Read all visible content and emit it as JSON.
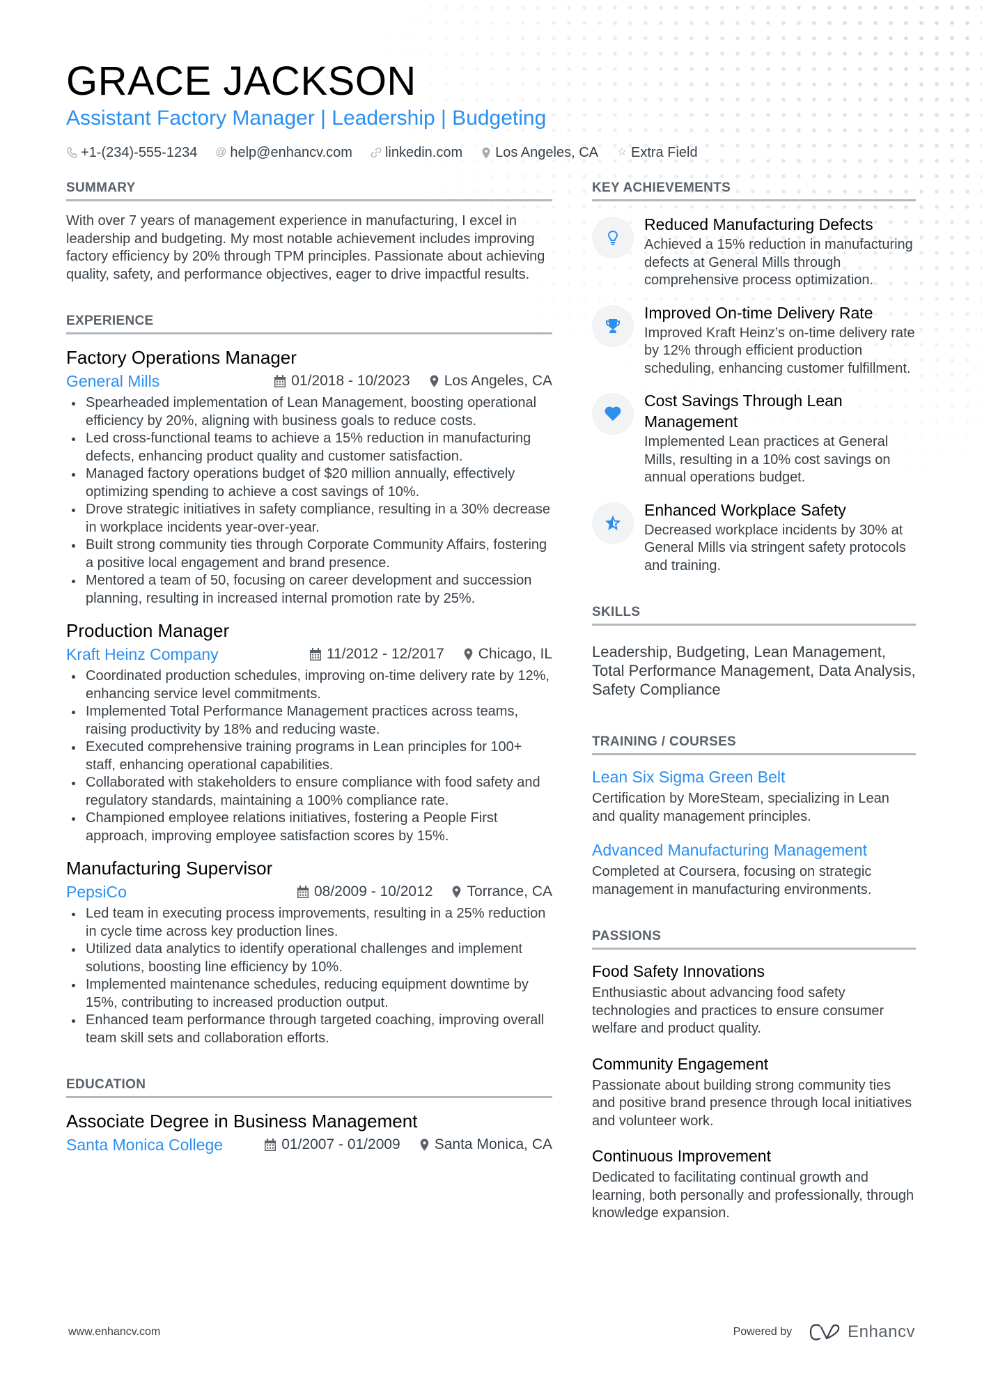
{
  "header": {
    "name": "GRACE JACKSON",
    "title": "Assistant Factory Manager | Leadership | Budgeting",
    "contacts": [
      {
        "icon": "phone-icon",
        "text": "+1-(234)-555-1234"
      },
      {
        "icon": "at-icon",
        "text": "help@enhancv.com"
      },
      {
        "icon": "link-icon",
        "text": "linkedin.com"
      },
      {
        "icon": "location-icon",
        "text": "Los Angeles, CA"
      },
      {
        "icon": "star-icon",
        "text": "Extra Field"
      }
    ]
  },
  "summary": {
    "heading": "SUMMARY",
    "text": "With over 7 years of management experience in manufacturing, I excel in leadership and budgeting. My most notable achievement includes improving factory efficiency by 20% through TPM principles. Passionate about achieving quality, safety, and performance objectives, eager to drive impactful results."
  },
  "experience": {
    "heading": "EXPERIENCE",
    "jobs": [
      {
        "title": "Factory Operations Manager",
        "company": "General Mills",
        "dates": "01/2018 - 10/2023",
        "location": "Los Angeles, CA",
        "bullets": [
          "Spearheaded implementation of Lean Management, boosting operational efficiency by 20%, aligning with business goals to reduce costs.",
          "Led cross-functional teams to achieve a 15% reduction in manufacturing defects, enhancing product quality and customer satisfaction.",
          "Managed factory operations budget of $20 million annually, effectively optimizing spending to achieve a cost savings of 10%.",
          "Drove strategic initiatives in safety compliance, resulting in a 30% decrease in workplace incidents year-over-year.",
          "Built strong community ties through Corporate Community Affairs, fostering a positive local engagement and brand presence.",
          "Mentored a team of 50, focusing on career development and succession planning, resulting in increased internal promotion rate by 25%."
        ]
      },
      {
        "title": "Production Manager",
        "company": "Kraft Heinz Company",
        "dates": "11/2012 - 12/2017",
        "location": "Chicago, IL",
        "bullets": [
          "Coordinated production schedules, improving on-time delivery rate by 12%, enhancing service level commitments.",
          "Implemented Total Performance Management practices across teams, raising productivity by 18% and reducing waste.",
          "Executed comprehensive training programs in Lean principles for 100+ staff, enhancing operational capabilities.",
          "Collaborated with stakeholders to ensure compliance with food safety and regulatory standards, maintaining a 100% compliance rate.",
          "Championed employee relations initiatives, fostering a People First approach, improving employee satisfaction scores by 15%."
        ]
      },
      {
        "title": "Manufacturing Supervisor",
        "company": "PepsiCo",
        "dates": "08/2009 - 10/2012",
        "location": "Torrance, CA",
        "bullets": [
          "Led team in executing process improvements, resulting in a 25% reduction in cycle time across key production lines.",
          "Utilized data analytics to identify operational challenges and implement solutions, boosting line efficiency by 10%.",
          "Implemented maintenance schedules, reducing equipment downtime by 15%, contributing to increased production output.",
          "Enhanced team performance through targeted coaching, improving overall team skill sets and collaboration efforts."
        ]
      }
    ]
  },
  "education": {
    "heading": "EDUCATION",
    "items": [
      {
        "degree": "Associate Degree in Business Management",
        "school": "Santa Monica College",
        "dates": "01/2007 - 01/2009",
        "location": "Santa Monica, CA"
      }
    ]
  },
  "achievements": {
    "heading": "KEY ACHIEVEMENTS",
    "items": [
      {
        "icon": "lightbulb-icon",
        "title": "Reduced Manufacturing Defects",
        "desc": "Achieved a 15% reduction in manufacturing defects at General Mills through comprehensive process optimization."
      },
      {
        "icon": "trophy-icon",
        "title": "Improved On-time Delivery Rate",
        "desc": "Improved Kraft Heinz’s on-time delivery rate by 12% through efficient production scheduling, enhancing customer fulfillment."
      },
      {
        "icon": "heart-icon",
        "title": "Cost Savings Through Lean Management",
        "desc": "Implemented Lean practices at General Mills, resulting in a 10% cost savings on annual operations budget."
      },
      {
        "icon": "star-icon",
        "title": "Enhanced Workplace Safety",
        "desc": "Decreased workplace incidents by 30% at General Mills via stringent safety protocols and training."
      }
    ]
  },
  "skills": {
    "heading": "SKILLS",
    "text": "Leadership, Budgeting, Lean Management, Total Performance Management, Data Analysis, Safety Compliance"
  },
  "training": {
    "heading": "TRAINING / COURSES",
    "items": [
      {
        "title": "Lean Six Sigma Green Belt",
        "desc": "Certification by MoreSteam, specializing in Lean and quality management principles."
      },
      {
        "title": "Advanced Manufacturing Management",
        "desc": "Completed at Coursera, focusing on strategic management in manufacturing environments."
      }
    ]
  },
  "passions": {
    "heading": "PASSIONS",
    "items": [
      {
        "title": "Food Safety Innovations",
        "desc": "Enthusiastic about advancing food safety technologies and practices to ensure consumer welfare and product quality."
      },
      {
        "title": "Community Engagement",
        "desc": "Passionate about building strong community ties and positive brand presence through local initiatives and volunteer work."
      },
      {
        "title": "Continuous Improvement",
        "desc": "Dedicated to facilitating continual growth and learning, both personally and professionally, through knowledge expansion."
      }
    ]
  },
  "footer": {
    "website": "www.enhancv.com",
    "powered_by": "Powered by",
    "brand": "Enhancv"
  },
  "colors": {
    "accent": "#2b8ff0",
    "text": "#384047",
    "heading_rule": "#b3b7bb"
  }
}
